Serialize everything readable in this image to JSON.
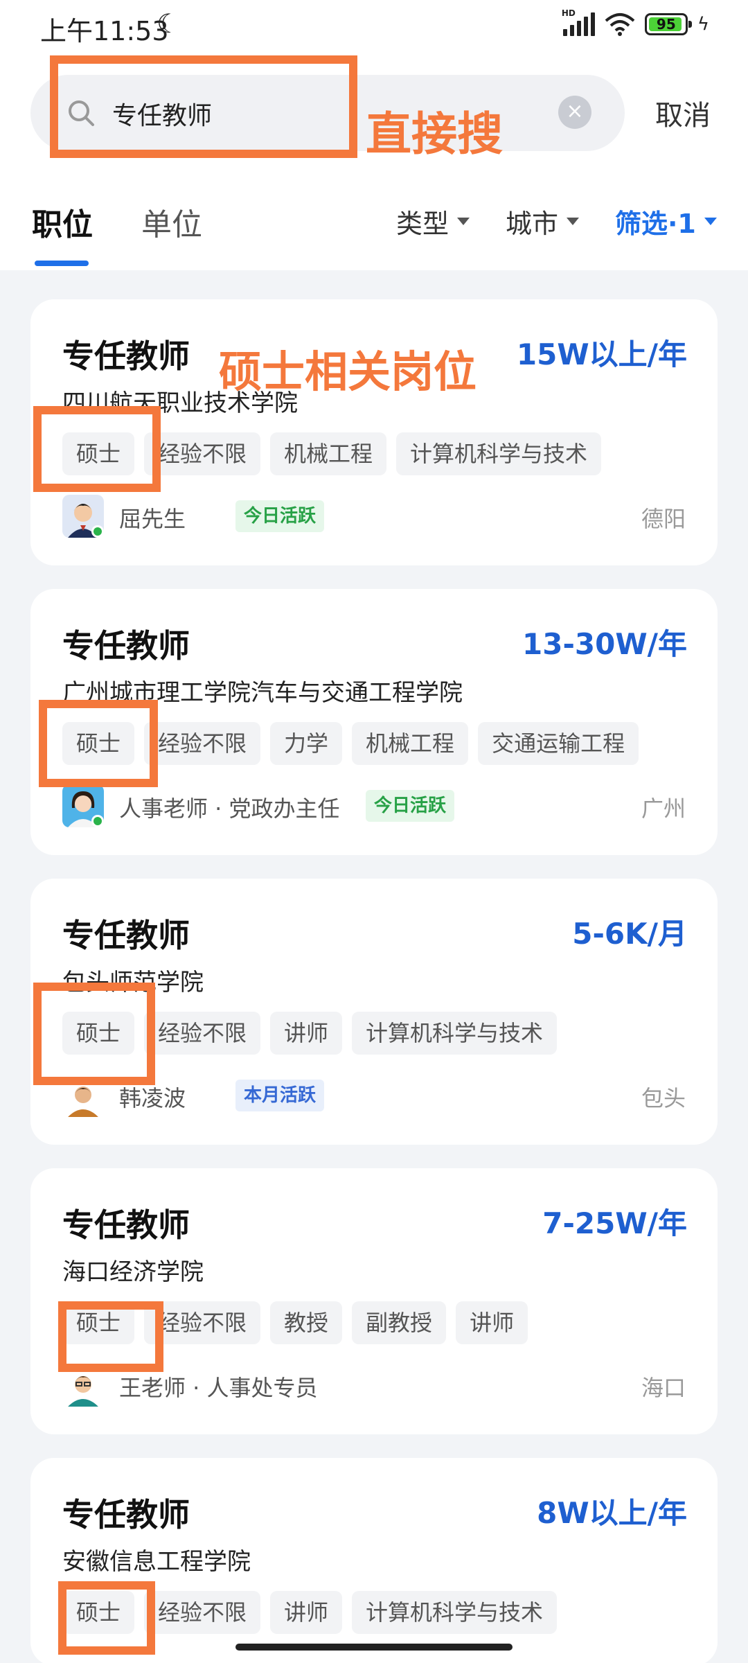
{
  "status": {
    "time": "上午11:53",
    "battery": "95",
    "hd_label": "HD"
  },
  "search": {
    "query": "专任教师",
    "cancel_label": "取消"
  },
  "annotations": {
    "search_note": "直接搜",
    "card_note": "硕士相关岗位"
  },
  "tabs": [
    {
      "label": "职位"
    },
    {
      "label": "单位"
    }
  ],
  "filters": {
    "type": "类型",
    "city": "城市",
    "screen": "筛选·1"
  },
  "jobs": [
    {
      "title": "专任教师",
      "salary": "15W以上/年",
      "company": "四川航天职业技术学院",
      "tags": [
        "硕士",
        "经验不限",
        "机械工程",
        "计算机科学与技术"
      ],
      "recruiter": "屈先生",
      "activity": "今日活跃",
      "city": "德阳"
    },
    {
      "title": "专任教师",
      "salary": "13-30W/年",
      "company": "广州城市理工学院汽车与交通工程学院",
      "tags": [
        "硕士",
        "经验不限",
        "力学",
        "机械工程",
        "交通运输工程"
      ],
      "recruiter": "人事老师 · 党政办主任",
      "activity": "今日活跃",
      "city": "广州"
    },
    {
      "title": "专任教师",
      "salary": "5-6K/月",
      "company": "包头师范学院",
      "tags": [
        "硕士",
        "经验不限",
        "讲师",
        "计算机科学与技术"
      ],
      "recruiter": "韩凌波",
      "activity": "本月活跃",
      "city": "包头"
    },
    {
      "title": "专任教师",
      "salary": "7-25W/年",
      "company": "海口经济学院",
      "tags": [
        "硕士",
        "经验不限",
        "教授",
        "副教授",
        "讲师"
      ],
      "recruiter": "王老师 · 人事处专员",
      "activity": "",
      "city": "海口"
    },
    {
      "title": "专任教师",
      "salary": "8W以上/年",
      "company": "安徽信息工程学院",
      "tags": [
        "硕士",
        "经验不限",
        "讲师",
        "计算机科学与技术"
      ]
    }
  ],
  "colors": {
    "accent": "#1e6fe8",
    "salary": "#1e5fd0",
    "annotation": "#f4783c"
  }
}
